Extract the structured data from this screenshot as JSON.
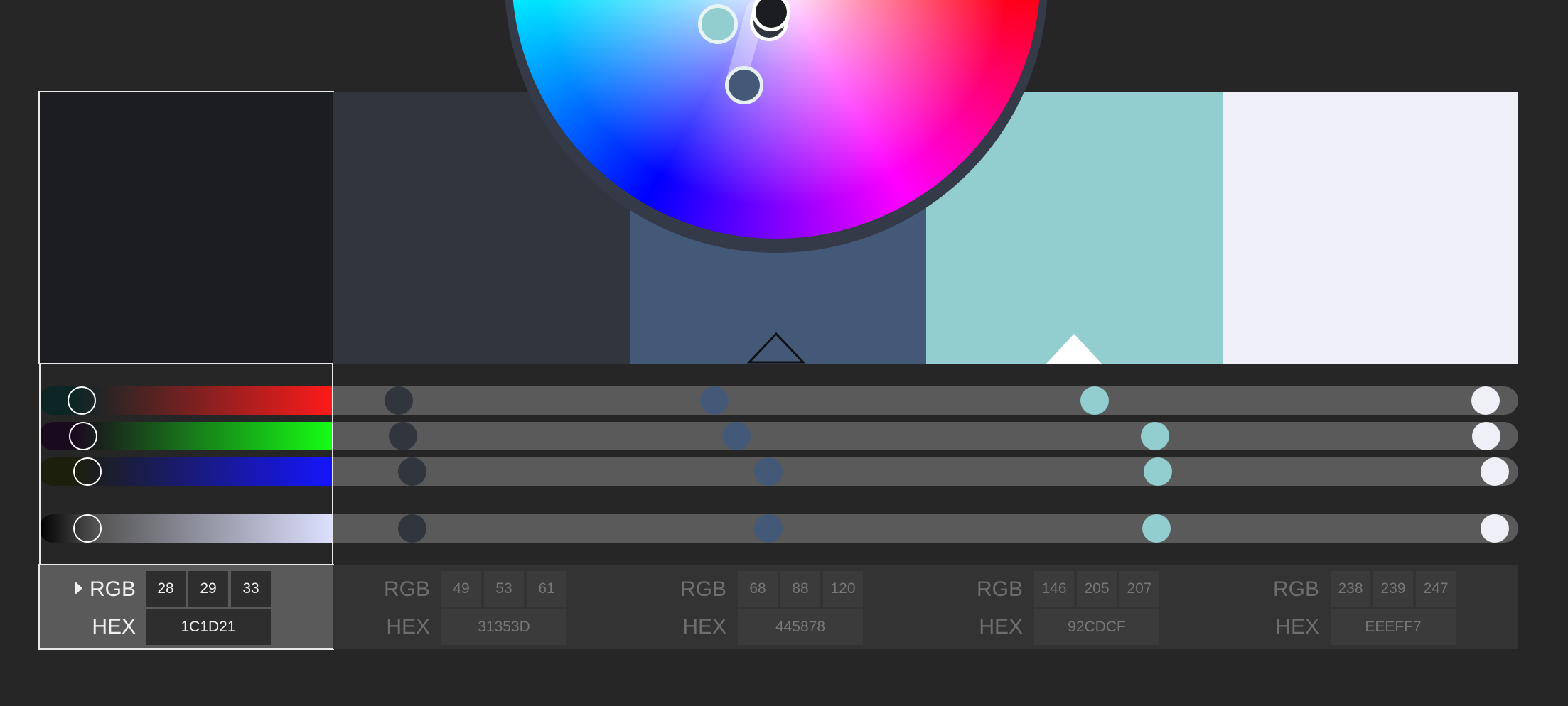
{
  "swatches": [
    {
      "hex": "#1c1d21",
      "active": true
    },
    {
      "hex": "#31353d",
      "active": false
    },
    {
      "hex": "#445878",
      "active": false
    },
    {
      "hex": "#92cdcf",
      "active": false
    },
    {
      "hex": "#eeeff7",
      "active": false
    }
  ],
  "colors": [
    {
      "rgb_label": "RGB",
      "hex_label": "HEX",
      "r": "28",
      "g": "29",
      "b": "33",
      "hex": "1C1D21"
    },
    {
      "rgb_label": "RGB",
      "hex_label": "HEX",
      "r": "49",
      "g": "53",
      "b": "61",
      "hex": "31353D"
    },
    {
      "rgb_label": "RGB",
      "hex_label": "HEX",
      "r": "68",
      "g": "88",
      "b": "120",
      "hex": "445878"
    },
    {
      "rgb_label": "RGB",
      "hex_label": "HEX",
      "r": "146",
      "g": "205",
      "b": "207",
      "hex": "92CDCF"
    },
    {
      "rgb_label": "RGB",
      "hex_label": "HEX",
      "r": "238",
      "g": "239",
      "b": "247",
      "hex": "EEEFF7"
    }
  ],
  "sliders": {
    "channels": [
      "red",
      "green",
      "blue",
      "brightness"
    ],
    "gradient_colors": {
      "red": [
        "#0c2626",
        "#ff1a1a"
      ],
      "green": [
        "#1a0a1e",
        "#15ff15"
      ],
      "blue": [
        "#1c1f0c",
        "#1515ff"
      ],
      "brightness": [
        "#000000",
        "#dde1ff"
      ]
    }
  },
  "icons": {
    "expand": "caret-right-icon",
    "base_marker": "triangle-outline-icon",
    "selected_marker": "triangle-filled-icon"
  },
  "accent": "#e8e8e8"
}
